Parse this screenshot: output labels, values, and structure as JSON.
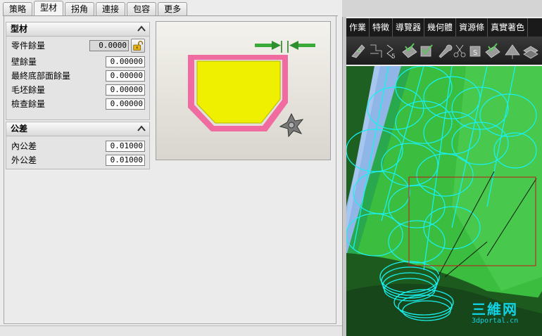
{
  "tabs": [
    {
      "label": "策略",
      "active": false
    },
    {
      "label": "型材",
      "active": true
    },
    {
      "label": "拐角",
      "active": false
    },
    {
      "label": "連接",
      "active": false
    },
    {
      "label": "包容",
      "active": false
    },
    {
      "label": "更多",
      "active": false
    }
  ],
  "stock_section": {
    "title": "型材",
    "fields": [
      {
        "label": "零件餘量",
        "value": "0.0000",
        "locked": true
      },
      {
        "label": "壁餘量",
        "value": "0.00000"
      },
      {
        "label": "最終底部面餘量",
        "value": "0.00000"
      },
      {
        "label": "毛坯餘量",
        "value": "0.00000"
      },
      {
        "label": "檢查餘量",
        "value": "0.00000"
      }
    ]
  },
  "tolerance_section": {
    "title": "公差",
    "fields": [
      {
        "label": "內公差",
        "value": "0.01000"
      },
      {
        "label": "外公差",
        "value": "0.01000"
      }
    ]
  },
  "cad_menu": [
    "作業",
    "特徵",
    "導覽器",
    "幾何體",
    "資源條",
    "真實著色"
  ],
  "watermark": {
    "line1": "三維网",
    "line2": "3dportal.cn"
  },
  "colors": {
    "accent_tab_bg": "#f4f4f4",
    "preview_yellow": "#eef000",
    "preview_pink": "#f06ca0",
    "cad_green": "#33b53a",
    "cad_wire": "#19f0f0",
    "selection_red": "#c01818"
  },
  "icons": [
    "chevron-up-icon",
    "lock-open-icon",
    "arrow-right-icon",
    "arrow-left-icon",
    "milling-cutter-icon"
  ]
}
